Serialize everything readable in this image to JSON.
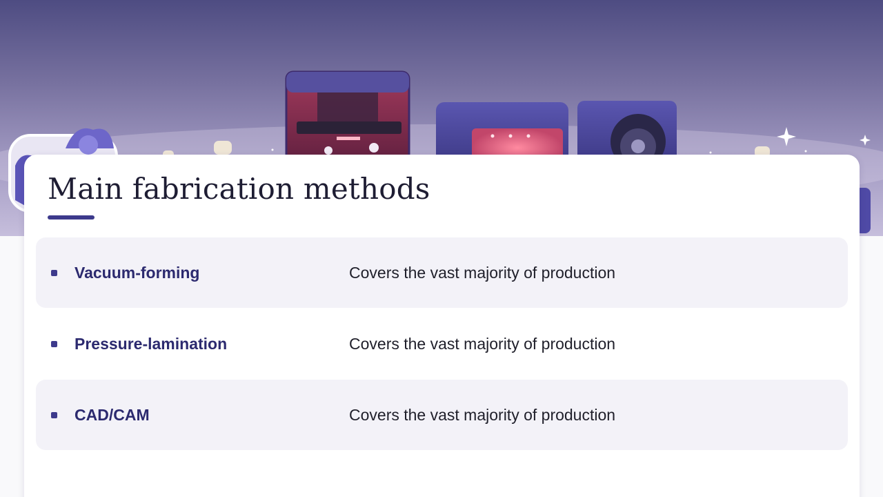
{
  "title": "Main fabrication methods",
  "rows": [
    {
      "method": "Vacuum-forming",
      "description": "Covers the vast majority of production",
      "shaded": true
    },
    {
      "method": "Pressure-lamination",
      "description": "Covers the vast majority of production",
      "shaded": false
    },
    {
      "method": "CAD/CAM",
      "description": "Covers the vast majority of production",
      "shaded": true
    }
  ],
  "colors": {
    "accent": "#3d3a8c",
    "method_text": "#2c2a6f",
    "row_shade": "#f3f2f8",
    "banner_top": "#4e4c82",
    "banner_bottom": "#c6bedc"
  },
  "banner_image": {
    "subject": "dental lab equipment: aligner case, 3D printer, curing unit, milling machine"
  }
}
